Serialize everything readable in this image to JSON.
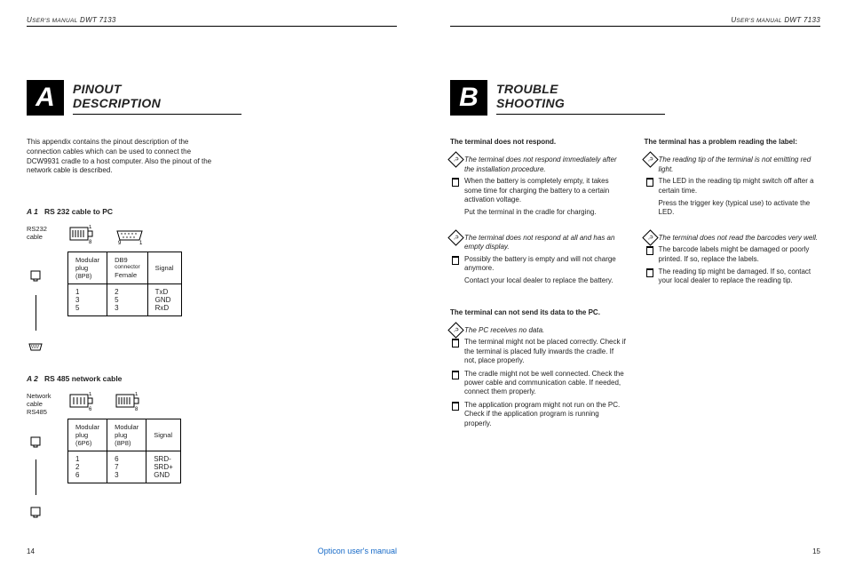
{
  "doc": {
    "header": "User's manual DWT 7133",
    "footer_link": "Opticon user's manual"
  },
  "pageA": {
    "letter": "A",
    "title_l1": "PINOUT",
    "title_l2": "DESCRIPTION",
    "intro": "This appendix contains the pinout description of the connection cables which can be used to connect the DCW9931 cradle to a host computer. Also the pinout of the network cable is described.",
    "pagenum": "14",
    "a1": {
      "num": "A 1",
      "title": "RS 232 cable to PC",
      "cable_label_l1": "RS232",
      "cable_label_l2": "cable",
      "headers": {
        "c1l1": "Modular",
        "c1l2": "plug",
        "c1l3": "(8P8)",
        "c2l1": "DB9",
        "c2l2": "connector",
        "c2l3": "Female",
        "c3": "Signal"
      },
      "rows": [
        {
          "a": "1",
          "b": "2",
          "s": "TxD"
        },
        {
          "a": "3",
          "b": "5",
          "s": "GND"
        },
        {
          "a": "5",
          "b": "3",
          "s": "RxD"
        }
      ]
    },
    "a2": {
      "num": "A 2",
      "title": "RS 485 network cable",
      "cable_label_l1": "Network",
      "cable_label_l2": "cable",
      "cable_label_l3": "RS485",
      "headers": {
        "c1l1": "Modular",
        "c1l2": "plug",
        "c1l3": "(6P6)",
        "c2l1": "Modular",
        "c2l2": "plug",
        "c2l3": "(8P8)",
        "c3": "Signal"
      },
      "rows": [
        {
          "a": "1",
          "b": "6",
          "s": "SRD-"
        },
        {
          "a": "2",
          "b": "7",
          "s": "SRD+"
        },
        {
          "a": "6",
          "b": "3",
          "s": "GND"
        }
      ]
    }
  },
  "pageB": {
    "letter": "B",
    "title_l1": "TROUBLE",
    "title_l2": "SHOOTING",
    "pagenum": "15",
    "col1": {
      "h1": "The terminal does not respond.",
      "q1": "The terminal does not respond immediately after the installation procedure.",
      "a1a": "When the battery is completely empty, it takes some time for charging the battery to a certain activation voltage.",
      "a1b": "Put the terminal in the cradle for charging.",
      "q2": "The terminal does not respond at all and has an empty display.",
      "a2a": "Possibly the battery is empty and will not charge anymore.",
      "a2b": "Contact your local dealer to replace the battery.",
      "h2": "The terminal can not send its data to the PC.",
      "q3": "The PC receives no data.",
      "a3a": "The terminal might not be placed correctly. Check if the terminal is placed fully inwards the cradle. If not, place properly.",
      "a3b": "The cradle might not be well connected. Check the power cable and communication cable. If needed, connect them properly.",
      "a3c": "The application program might not run on the PC. Check if the application program is running properly."
    },
    "col2": {
      "h1": "The terminal has a problem reading the label:",
      "q1": "The reading tip of the terminal is not emitting red light.",
      "a1a": "The LED in the reading tip might switch off after a certain time.",
      "a1b": "Press the trigger key (typical use) to activate the LED.",
      "q2": "The terminal does not read the barcodes very well.",
      "a2a": "The barcode labels might be damaged or poorly printed. If so, replace the labels.",
      "a2b": "The reading tip might be damaged. If so, contact your local dealer to replace the reading tip."
    }
  }
}
